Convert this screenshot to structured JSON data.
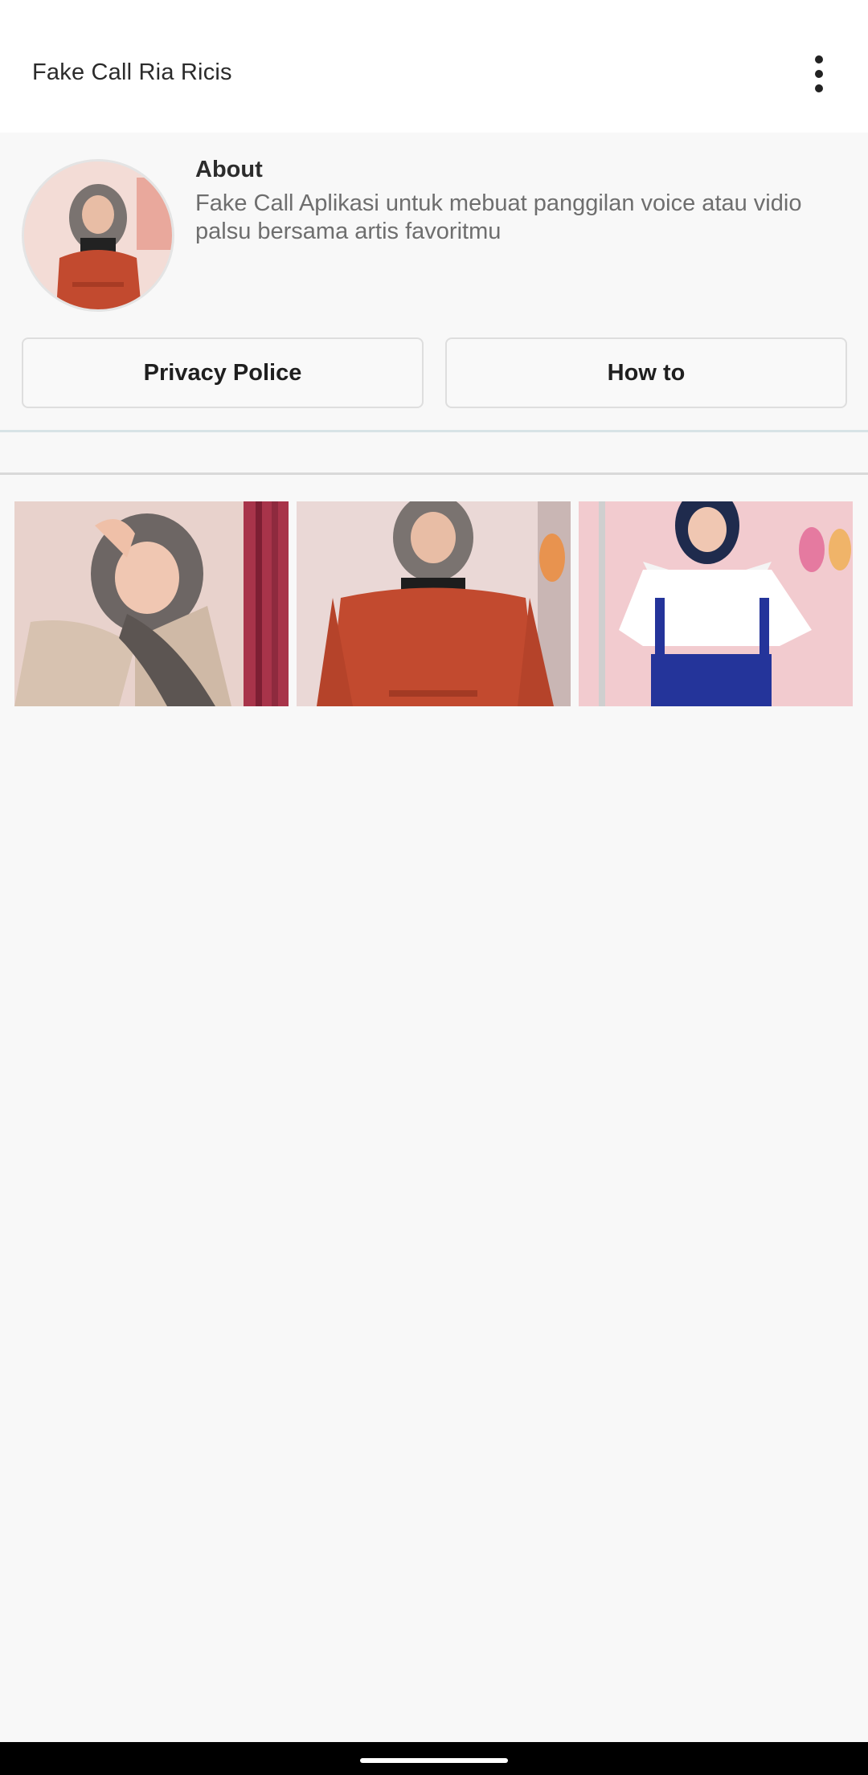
{
  "app_bar": {
    "title": "Fake Call Ria Ricis",
    "menu_icon": "more-vert-icon"
  },
  "profile": {
    "avatar_icon": "profile-avatar",
    "about_title": "About",
    "about_text": "Fake Call Aplikasi untuk mebuat panggilan voice atau vidio palsu bersama artis favoritmu"
  },
  "buttons": {
    "privacy_label": "Privacy Police",
    "howto_label": "How to"
  },
  "gallery": {
    "photos": [
      "photo-thumbnail",
      "photo-thumbnail",
      "photo-thumbnail"
    ]
  },
  "colors": {
    "app_bar_bg": "#ffffff",
    "page_bg": "#f8f8f8",
    "text_primary": "#222222",
    "text_secondary": "#6e6e6e",
    "divider_accent": "#d8e3e6"
  }
}
